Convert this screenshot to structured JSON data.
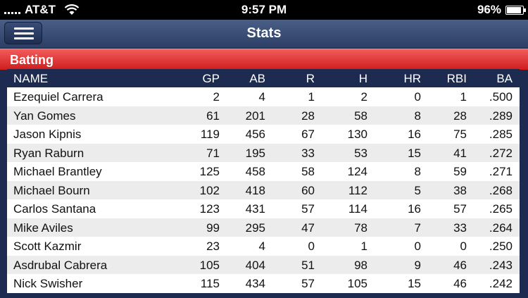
{
  "status": {
    "carrier": "AT&T",
    "time": "9:57 PM",
    "battery": "96%",
    "battery_level": 0.96
  },
  "nav": {
    "title": "Stats"
  },
  "section": {
    "title": "Batting"
  },
  "columns": [
    "NAME",
    "GP",
    "AB",
    "R",
    "H",
    "HR",
    "RBI",
    "BA"
  ],
  "rows": [
    {
      "name": "Ezequiel Carrera",
      "gp": "2",
      "ab": "4",
      "r": "1",
      "h": "2",
      "hr": "0",
      "rbi": "1",
      "ba": ".500"
    },
    {
      "name": "Yan Gomes",
      "gp": "61",
      "ab": "201",
      "r": "28",
      "h": "58",
      "hr": "8",
      "rbi": "28",
      "ba": ".289"
    },
    {
      "name": "Jason Kipnis",
      "gp": "119",
      "ab": "456",
      "r": "67",
      "h": "130",
      "hr": "16",
      "rbi": "75",
      "ba": ".285"
    },
    {
      "name": "Ryan Raburn",
      "gp": "71",
      "ab": "195",
      "r": "33",
      "h": "53",
      "hr": "15",
      "rbi": "41",
      "ba": ".272"
    },
    {
      "name": "Michael Brantley",
      "gp": "125",
      "ab": "458",
      "r": "58",
      "h": "124",
      "hr": "8",
      "rbi": "59",
      "ba": ".271"
    },
    {
      "name": "Michael Bourn",
      "gp": "102",
      "ab": "418",
      "r": "60",
      "h": "112",
      "hr": "5",
      "rbi": "38",
      "ba": ".268"
    },
    {
      "name": "Carlos Santana",
      "gp": "123",
      "ab": "431",
      "r": "57",
      "h": "114",
      "hr": "16",
      "rbi": "57",
      "ba": ".265"
    },
    {
      "name": "Mike Aviles",
      "gp": "99",
      "ab": "295",
      "r": "47",
      "h": "78",
      "hr": "7",
      "rbi": "33",
      "ba": ".264"
    },
    {
      "name": "Scott Kazmir",
      "gp": "23",
      "ab": "4",
      "r": "0",
      "h": "1",
      "hr": "0",
      "rbi": "0",
      "ba": ".250"
    },
    {
      "name": "Asdrubal Cabrera",
      "gp": "105",
      "ab": "404",
      "r": "51",
      "h": "98",
      "hr": "9",
      "rbi": "46",
      "ba": ".243"
    },
    {
      "name": "Nick Swisher",
      "gp": "115",
      "ab": "434",
      "r": "57",
      "h": "105",
      "hr": "15",
      "rbi": "46",
      "ba": ".242"
    }
  ]
}
